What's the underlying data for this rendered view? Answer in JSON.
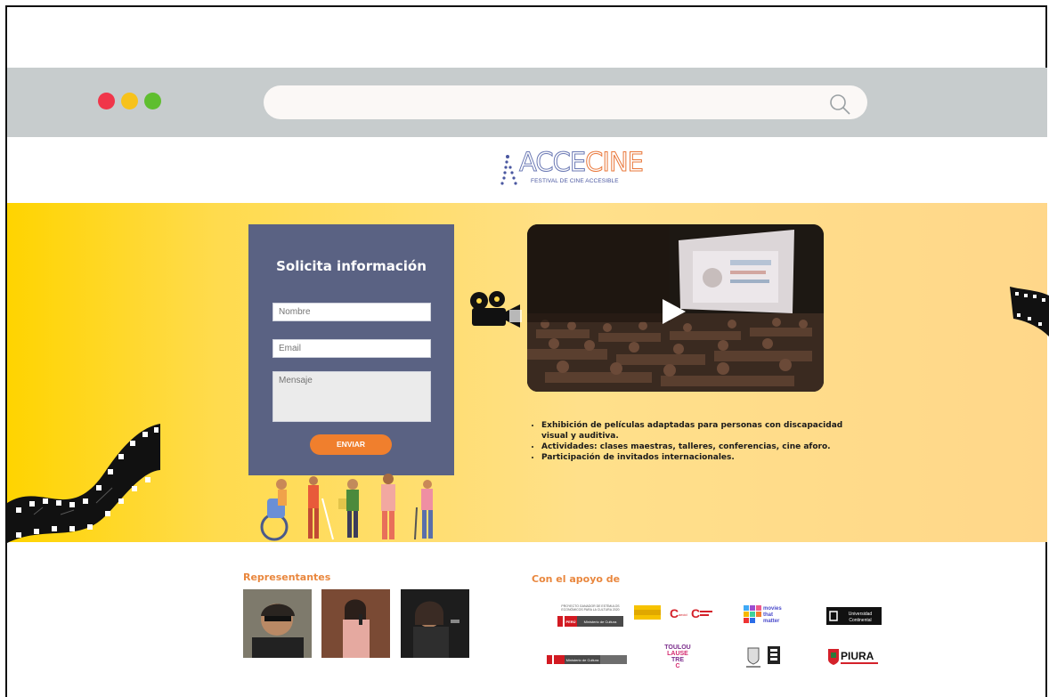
{
  "browser": {
    "window_controls": [
      "close",
      "minimize",
      "maximize"
    ],
    "address_bar": {
      "value": "",
      "icon": "search-icon"
    }
  },
  "brand": {
    "logo_main_a": "ACCE",
    "logo_main_b": "CINE",
    "logo_subtitle": "FESTIVAL DE CINE ACCESIBLE"
  },
  "form": {
    "title": "Solicita información",
    "nombre_placeholder": "Nombre",
    "email_placeholder": "Email",
    "mensaje_placeholder": "Mensaje",
    "submit_label": "ENVIAR"
  },
  "video": {
    "play_icon": "play-icon"
  },
  "features": [
    "Exhibición de películas adaptadas para personas con discapacidad visual y auditiva.",
    "Actividades: clases maestras, talleres, conferencias, cine aforo.",
    "Participación de invitados internacionales."
  ],
  "representantes": {
    "title": "Representantes"
  },
  "sponsors": {
    "title": "Con el apoyo de",
    "items": [
      {
        "name": "PERÚ Ministerio de Cultura",
        "note": "PROYECTO GANADOR DE ESTÍMULOS ECONÓMICOS PARA LA CULTURA 2020"
      },
      {
        "name": "AECID"
      },
      {
        "name": "movies that matter"
      },
      {
        "name": "Universidad Continental"
      },
      {
        "name": "Ministerio de Cultura"
      },
      {
        "name": "TOULOU LAUSE TRE C"
      },
      {
        "name": "Municipalidad"
      },
      {
        "name": "PIURA"
      }
    ]
  },
  "colors": {
    "accent_orange": "#f07f2d",
    "form_bg": "#5a6283",
    "hero_yellow": "#ffd400",
    "browser_bar": "#c7cccd"
  }
}
